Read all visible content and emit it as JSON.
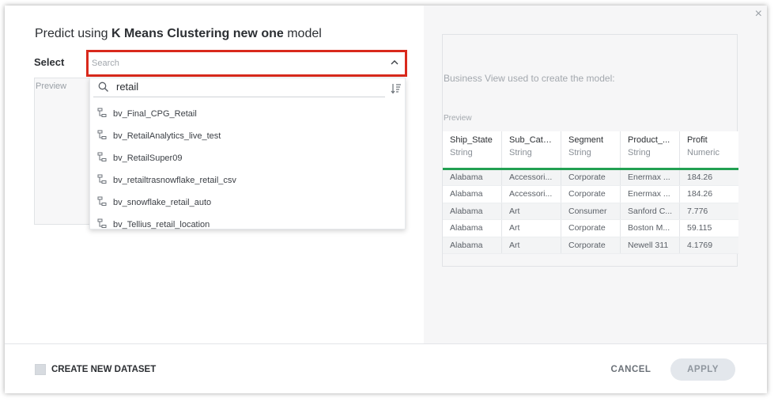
{
  "header": {
    "title_prefix": "Predict using",
    "model_name": "K Means Clustering new one",
    "title_suffix": "model",
    "close_glyph": "×"
  },
  "left": {
    "select_label": "Select",
    "preview_label": "Preview"
  },
  "search": {
    "placeholder": "Search",
    "filter_value": "retail",
    "icons": [
      "chevron-up-icon",
      "search-icon",
      "sort-icon",
      "business-view-icon"
    ]
  },
  "options": [
    {
      "label": "bv_Final_CPG_Retail"
    },
    {
      "label": "bv_RetailAnalytics_live_test"
    },
    {
      "label": "bv_RetailSuper09"
    },
    {
      "label": "bv_retailtrasnowflake_retail_csv"
    },
    {
      "label": "bv_snowflake_retail_auto"
    },
    {
      "label": "bv_Tellius_retail_location"
    }
  ],
  "business_view": {
    "title": "Business View used to create the model:",
    "preview_label": "Preview",
    "columns": [
      {
        "name": "Ship_State",
        "type": "String"
      },
      {
        "name": "Sub_Cate...",
        "type": "String"
      },
      {
        "name": "Segment",
        "type": "String"
      },
      {
        "name": "Product_...",
        "type": "String"
      },
      {
        "name": "Profit",
        "type": "Numeric"
      }
    ],
    "rows": [
      [
        "Alabama",
        "Accessori...",
        "Corporate",
        "Enermax ...",
        "184.26"
      ],
      [
        "Alabama",
        "Accessori...",
        "Corporate",
        "Enermax ...",
        "184.26"
      ],
      [
        "Alabama",
        "Art",
        "Consumer",
        "Sanford C...",
        "7.776"
      ],
      [
        "Alabama",
        "Art",
        "Corporate",
        "Boston M...",
        "59.115"
      ],
      [
        "Alabama",
        "Art",
        "Corporate",
        "Newell 311",
        "4.1769"
      ]
    ],
    "accent_color": "#22a052"
  },
  "footer": {
    "checkbox_label": "CREATE NEW DATASET",
    "cancel_label": "CANCEL",
    "apply_label": "APPLY"
  },
  "colors": {
    "highlight": "#d9291c",
    "apply_bg": "#e3e7ec"
  }
}
